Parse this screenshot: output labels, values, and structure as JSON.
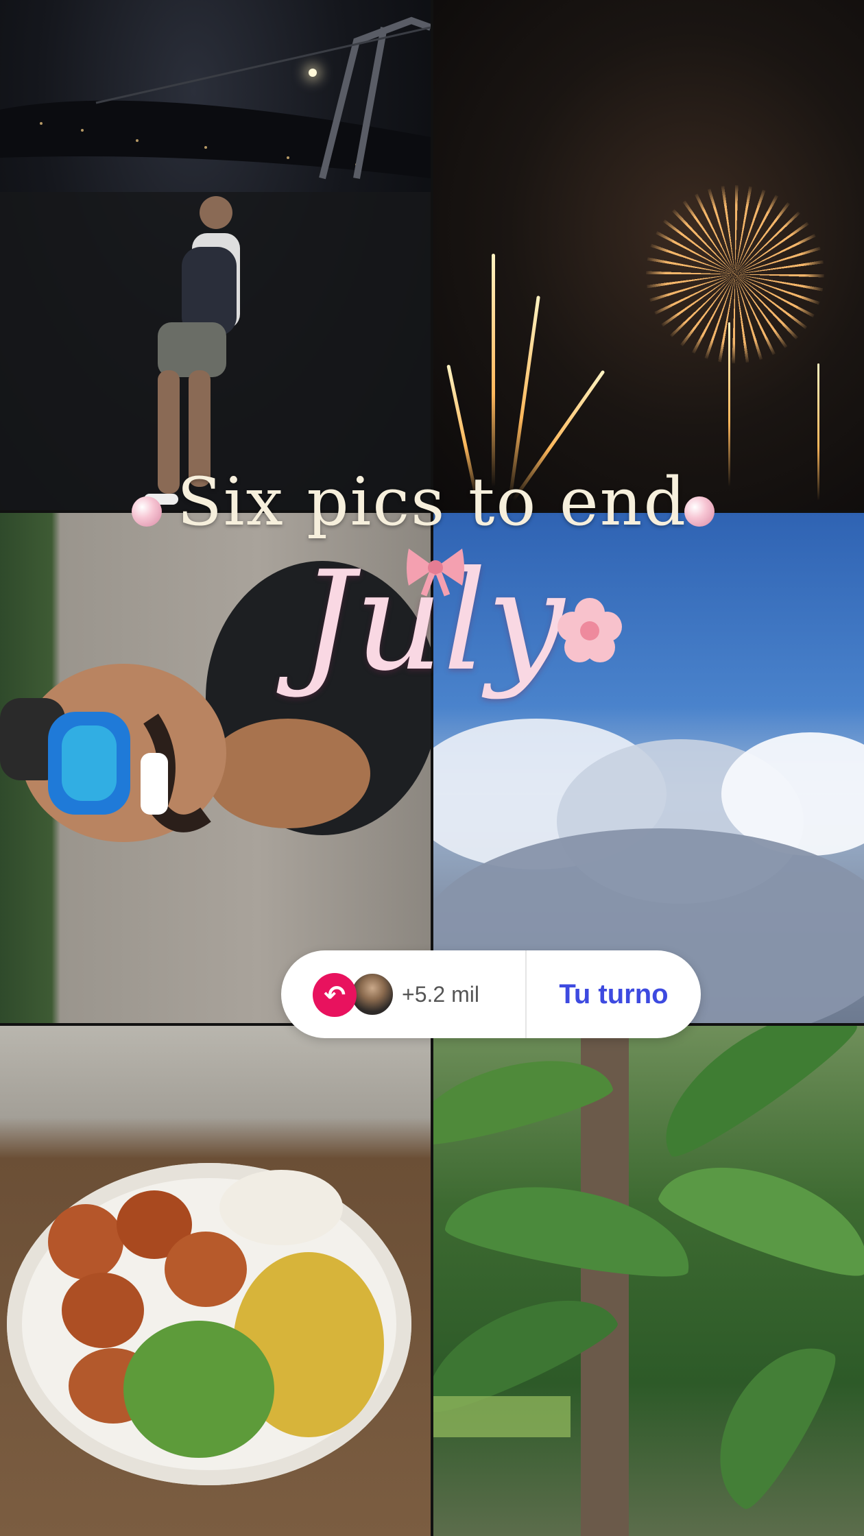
{
  "collage": {
    "title_line1": "Six pics to end",
    "title_line2": "July",
    "tiles": [
      {
        "name": "night-hike"
      },
      {
        "name": "fireworks"
      },
      {
        "name": "mountain-selfie"
      },
      {
        "name": "blue-sky-clouds"
      },
      {
        "name": "food-bowl"
      },
      {
        "name": "banana-plants"
      }
    ]
  },
  "prompt": {
    "participants": "+5.2 mil",
    "cta_label": "Tu turno",
    "accent_color": "#e8125e",
    "cta_color": "#3d4ae0",
    "reply_icon": "reply-arrow-icon"
  }
}
